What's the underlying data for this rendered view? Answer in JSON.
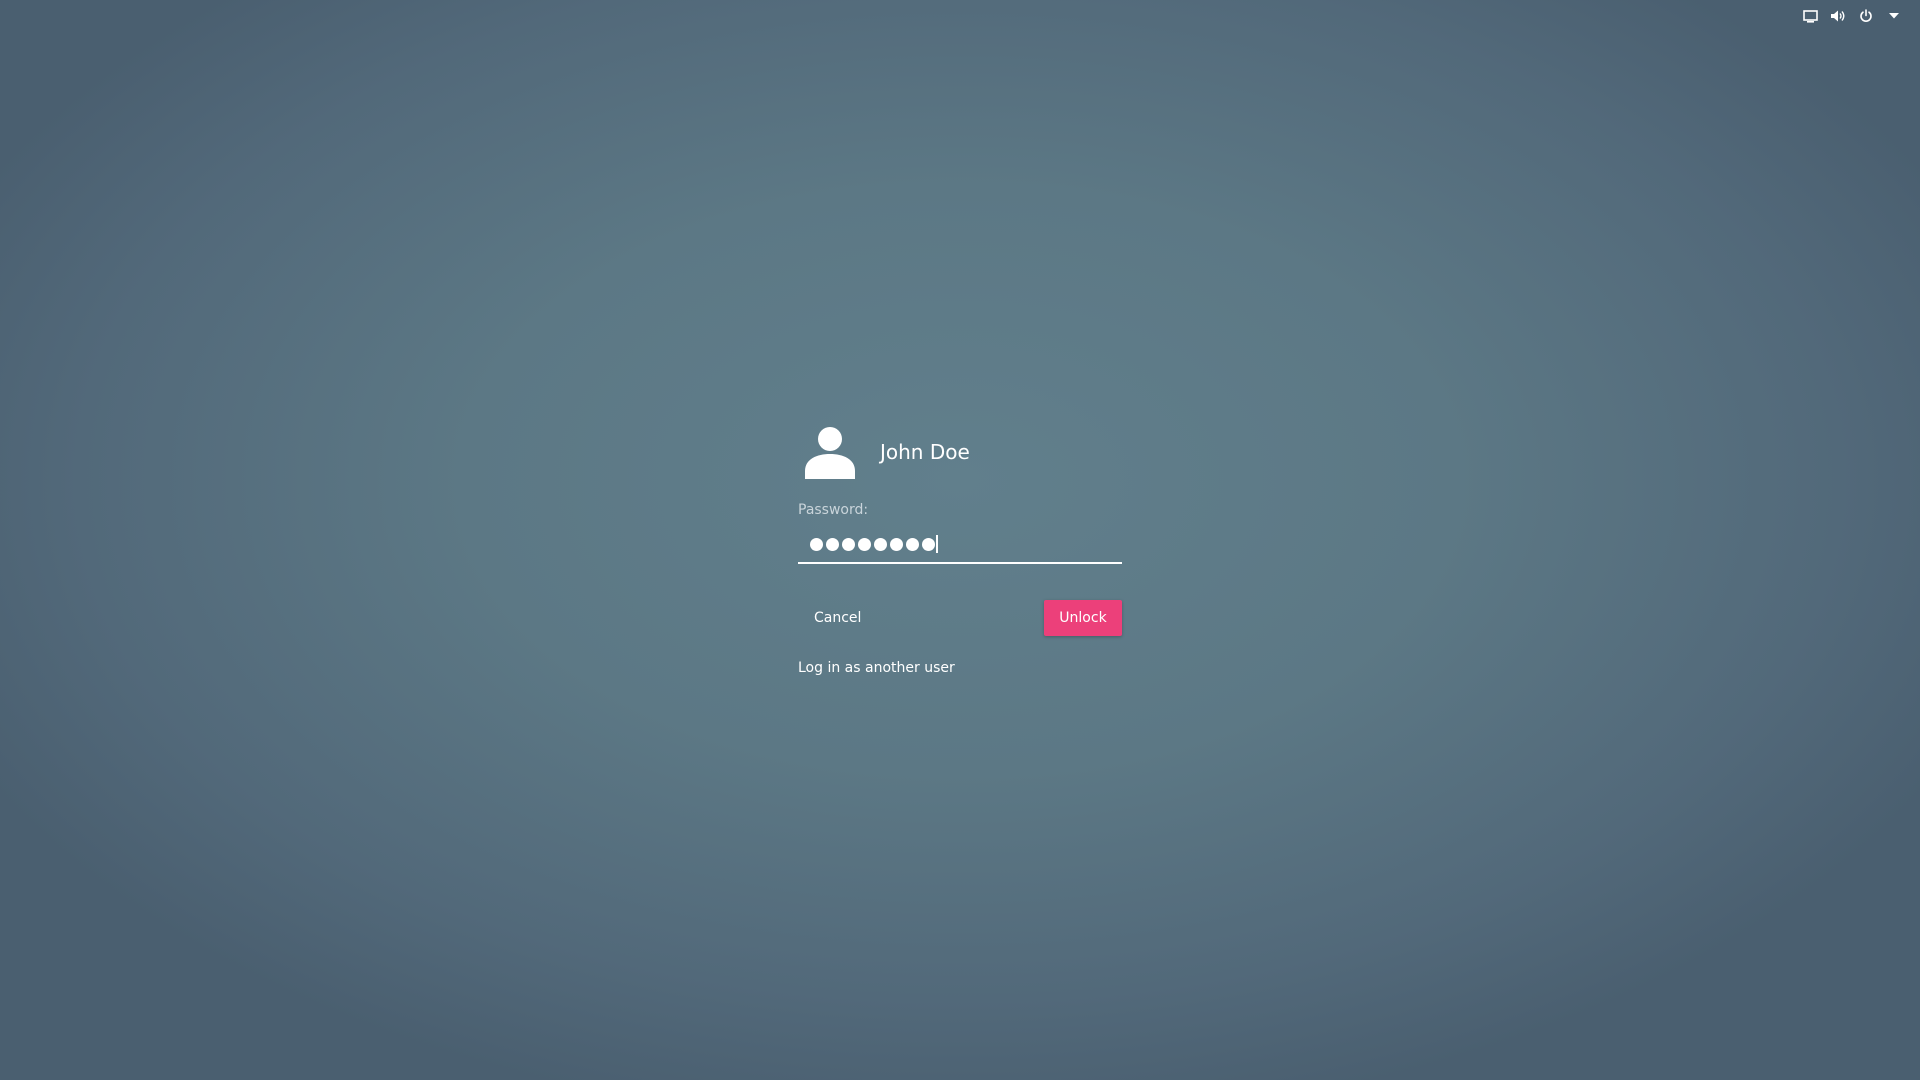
{
  "top_bar": {
    "icons": [
      "display-icon",
      "volume-icon",
      "power-icon",
      "menu-arrow-icon"
    ]
  },
  "login": {
    "user_name": "John Doe",
    "avatar_icon": "user-avatar-icon",
    "password_label": "Password:",
    "password_masked_length": 8,
    "cancel_label": "Cancel",
    "unlock_label": "Unlock",
    "alt_user_label": "Log in as another user"
  },
  "colors": {
    "accent": "#ec407a",
    "background": "#5c7885",
    "text": "#ffffff",
    "label": "#c9d4da"
  }
}
